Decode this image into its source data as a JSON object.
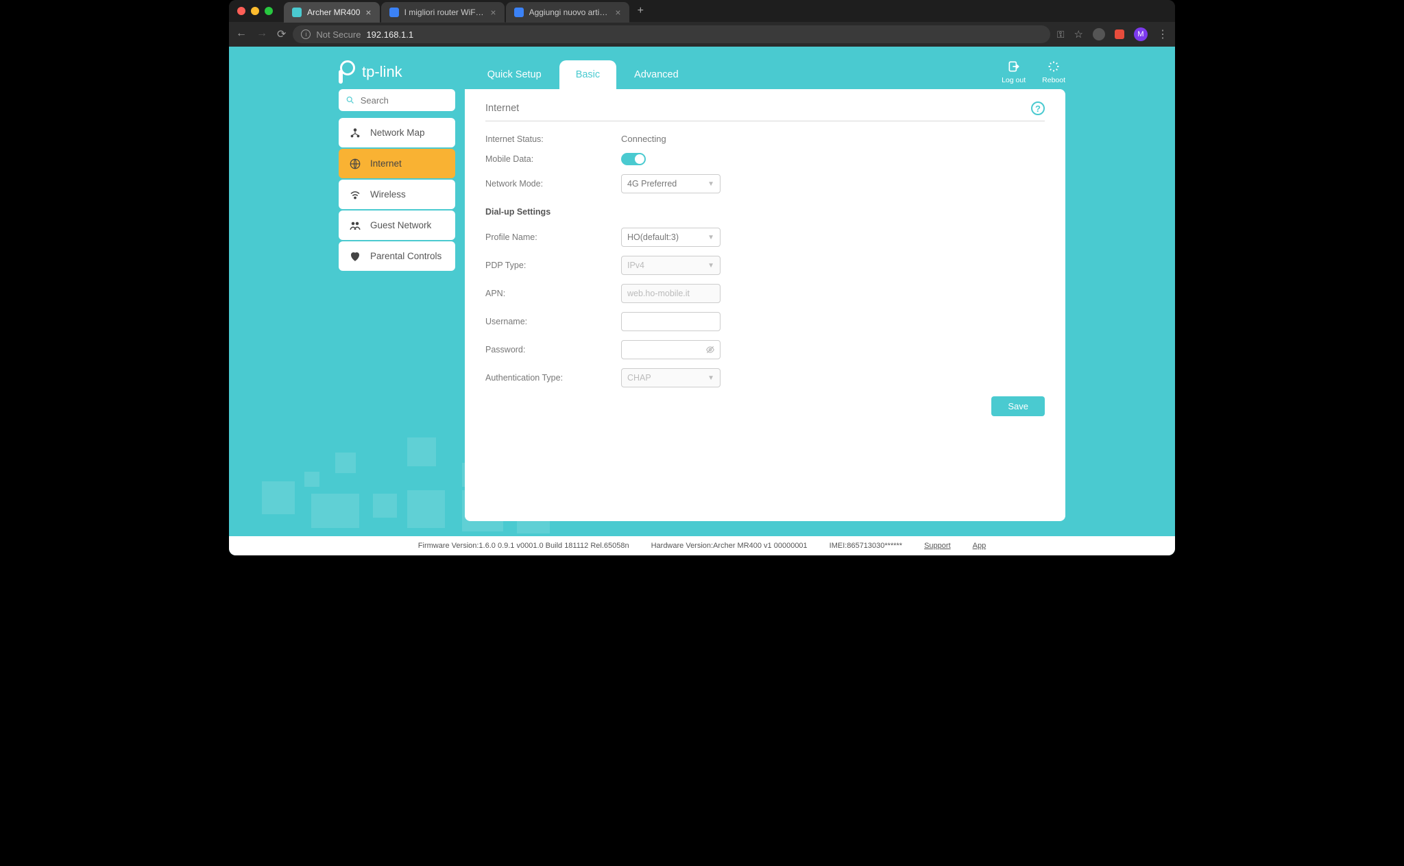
{
  "browser": {
    "tabs": [
      {
        "title": "Archer MR400",
        "active": true,
        "favicon": "tplink"
      },
      {
        "title": "I migliori router WiFi 4G con slo",
        "active": false,
        "favicon": "blue"
      },
      {
        "title": "Aggiungi nuovo articolo ‹ Tech",
        "active": false,
        "favicon": "blue"
      }
    ],
    "url": {
      "not_secure": "Not Secure",
      "text": "192.168.1.1"
    },
    "avatar": "M"
  },
  "logo_text": "tp-link",
  "main_tabs": {
    "quick_setup": "Quick Setup",
    "basic": "Basic",
    "advanced": "Advanced"
  },
  "header_actions": {
    "logout": "Log out",
    "reboot": "Reboot"
  },
  "search": {
    "placeholder": "Search"
  },
  "sidebar": {
    "network_map": "Network Map",
    "internet": "Internet",
    "wireless": "Wireless",
    "guest_network": "Guest Network",
    "parental_controls": "Parental Controls"
  },
  "panel": {
    "title": "Internet",
    "labels": {
      "internet_status": "Internet Status:",
      "mobile_data": "Mobile Data:",
      "network_mode": "Network Mode:",
      "dialup_section": "Dial-up Settings",
      "profile_name": "Profile Name:",
      "pdp_type": "PDP Type:",
      "apn": "APN:",
      "username": "Username:",
      "password": "Password:",
      "auth_type": "Authentication Type:"
    },
    "values": {
      "internet_status": "Connecting",
      "network_mode": "4G Preferred",
      "profile_name": "HO(default:3)",
      "pdp_type": "IPv4",
      "apn": "web.ho-mobile.it",
      "username": "",
      "password": "",
      "auth_type": "CHAP"
    },
    "save_label": "Save"
  },
  "footer": {
    "firmware": "Firmware Version:1.6.0 0.9.1 v0001.0 Build 181112 Rel.65058n",
    "hardware": "Hardware Version:Archer MR400 v1 00000001",
    "imei": "IMEI:865713030******",
    "support": "Support",
    "app": "App"
  }
}
